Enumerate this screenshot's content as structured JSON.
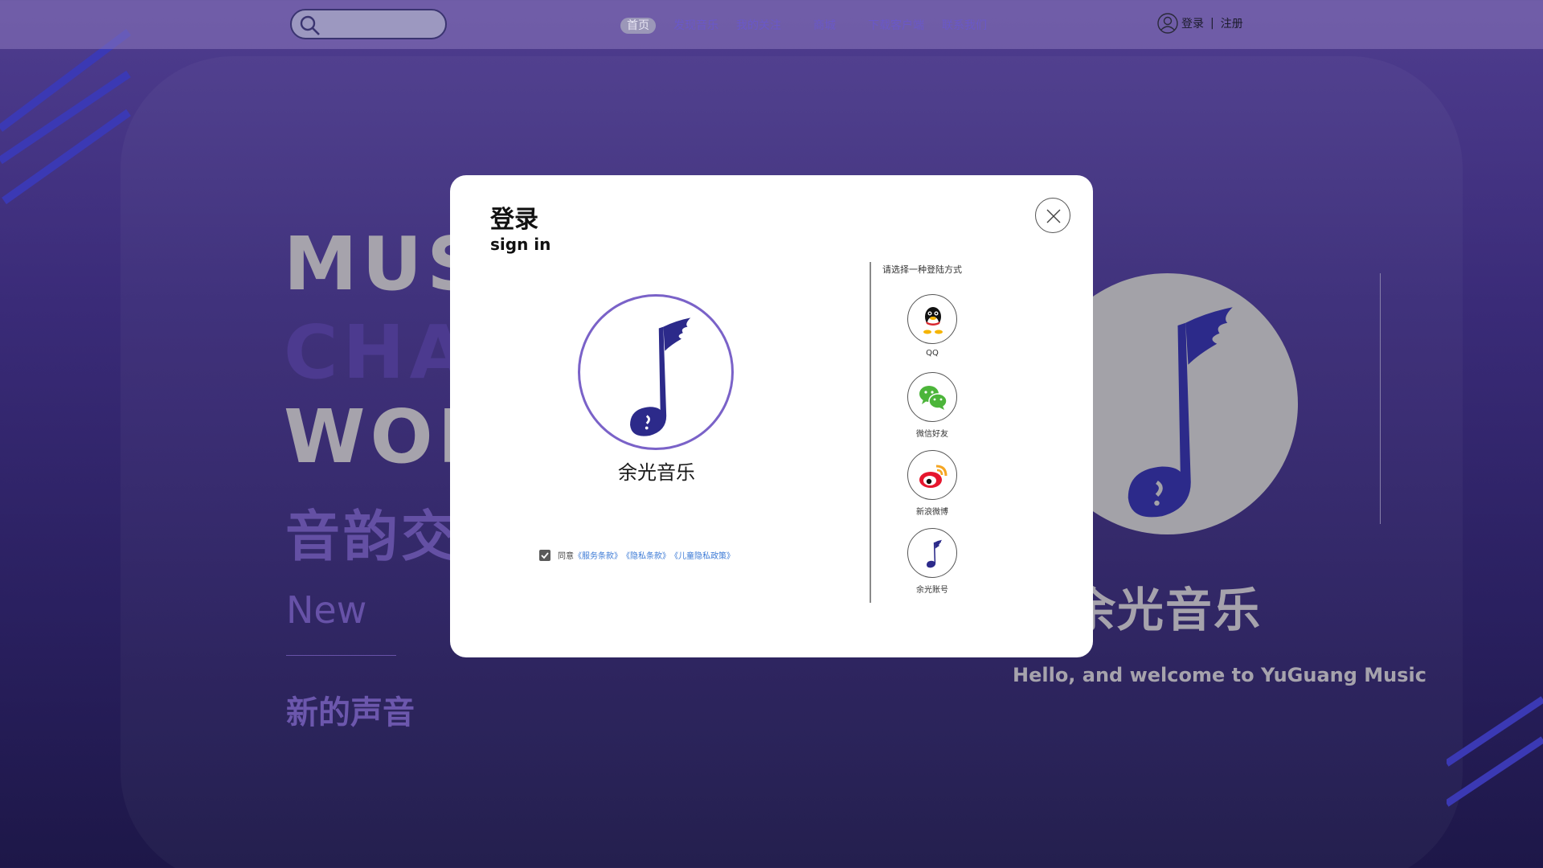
{
  "header": {
    "search_placeholder": "",
    "nav": [
      "首页",
      "发现音乐",
      "我的关注",
      "商城",
      "下载客户端",
      "联系我们"
    ],
    "active_nav": "首页",
    "login": "登录",
    "separator": "|",
    "register": "注册"
  },
  "hero": {
    "line1": "MUS",
    "line2": "CHA",
    "line3": "WOR",
    "line4": "音韵交",
    "new_label": "New",
    "new_sub": "新的声音"
  },
  "brand": {
    "name": "余光音乐",
    "welcome": "Hello, and welcome to YuGuang Music"
  },
  "modal": {
    "title": "登录",
    "subtitle": "sign in",
    "logo_name": "余光音乐",
    "agree_prefix": "同意",
    "terms": "《服务条款》",
    "privacy": "《隐私条款》",
    "child_privacy": "《儿童隐私政策》",
    "choose_label": "请选择一种登陆方式",
    "options": [
      {
        "label": "QQ",
        "icon": "qq-penguin-icon"
      },
      {
        "label": "微信好友",
        "icon": "wechat-icon"
      },
      {
        "label": "新浪微博",
        "icon": "weibo-icon"
      },
      {
        "label": "余光账号",
        "icon": "yuguang-music-note-icon"
      }
    ]
  },
  "colors": {
    "accent": "#2f2a8f",
    "ring": "#7a62c8",
    "link": "#3d7bd6",
    "wechat": "#4cb53a",
    "weibo": "#e6162d"
  }
}
